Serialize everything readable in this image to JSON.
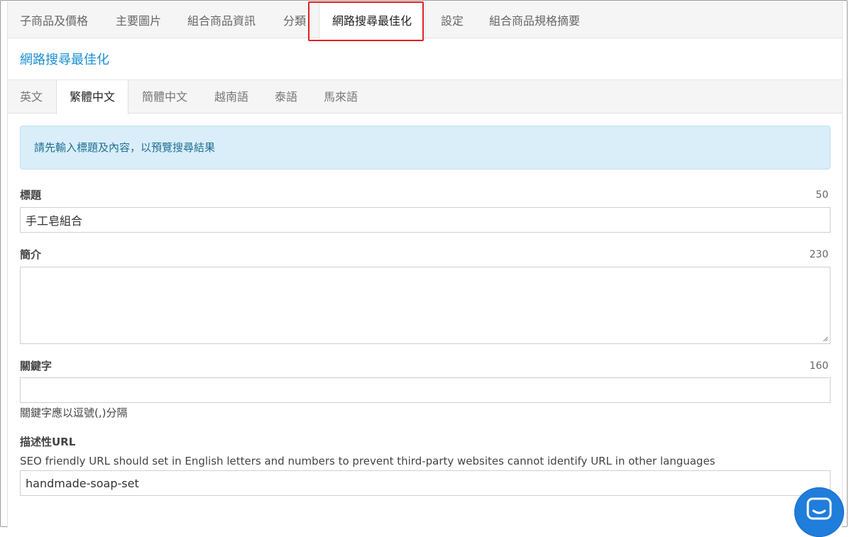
{
  "top_tabs": [
    "子商品及價格",
    "主要圖片",
    "組合商品資訊",
    "分類",
    "網路搜尋最佳化",
    "設定",
    "組合商品規格摘要"
  ],
  "active_top_tab": "網路搜尋最佳化",
  "section_title": "網路搜尋最佳化",
  "lang_tabs": [
    "英文",
    "繁體中文",
    "簡體中文",
    "越南語",
    "泰語",
    "馬來語"
  ],
  "active_lang_tab": "繁體中文",
  "alert_text": "請先輸入標題及內容，以預覽搜尋結果",
  "fields": {
    "title": {
      "label": "標題",
      "count": "50",
      "value": "手工皂組合"
    },
    "intro": {
      "label": "簡介",
      "count": "230",
      "value": ""
    },
    "keywords": {
      "label": "關鍵字",
      "count": "160",
      "value": "",
      "hint": "關鍵字應以逗號(,)分隔"
    },
    "url": {
      "label": "描述性URL",
      "hint": "SEO friendly URL should set in English letters and numbers to prevent third-party websites cannot identify URL in other languages",
      "value": "handmade-soap-set"
    }
  },
  "colors": {
    "accent": "#1a8fd0",
    "highlight": "#e02020",
    "alert_bg": "#d9eef8",
    "chat": "#1f7ddb"
  },
  "chat_icon": "chat-icon"
}
